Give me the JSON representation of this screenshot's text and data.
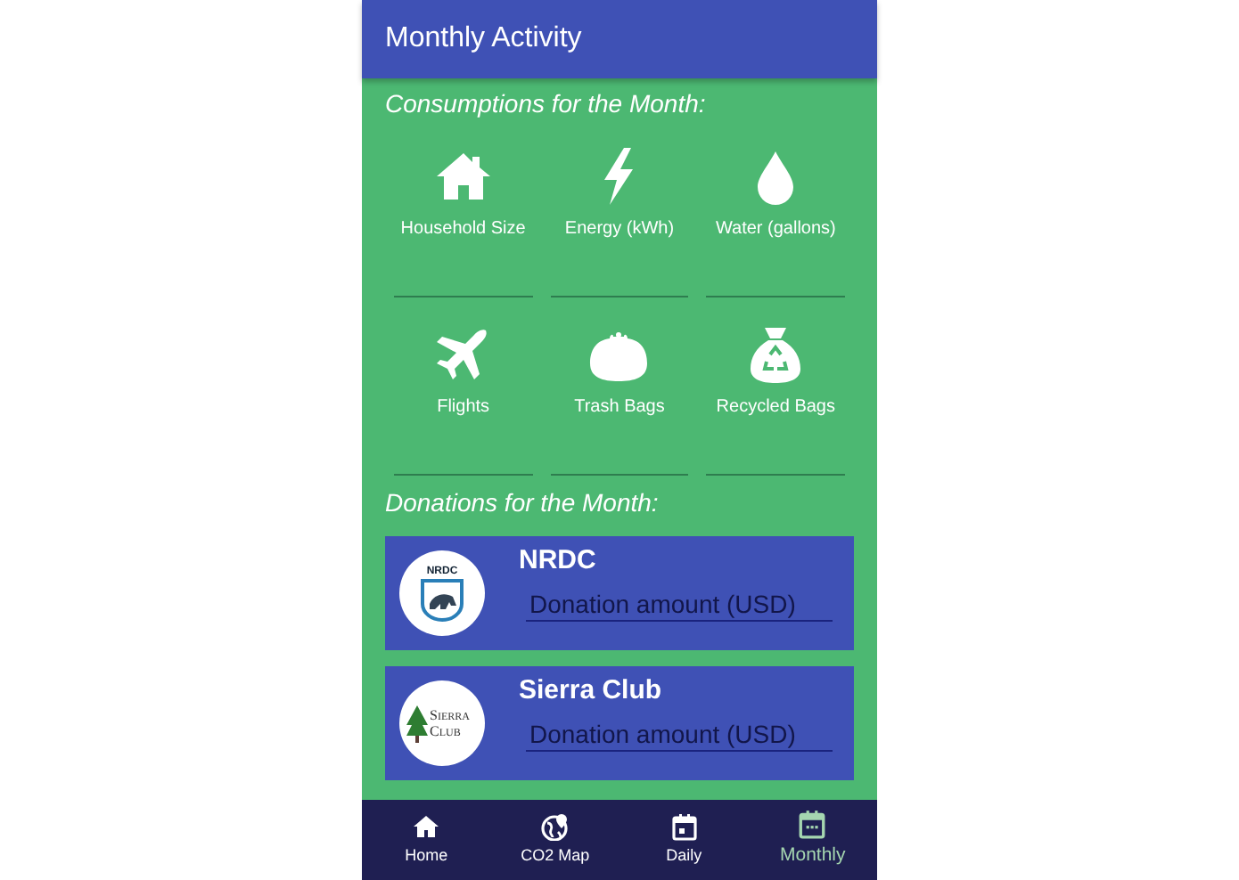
{
  "app_bar": {
    "title": "Monthly Activity"
  },
  "consumptions": {
    "heading": "Consumptions for the Month:",
    "items": [
      {
        "kind": "house",
        "label": "Household Size"
      },
      {
        "kind": "bolt",
        "label": "Energy (kWh)"
      },
      {
        "kind": "drop",
        "label": "Water (gallons)"
      },
      {
        "kind": "plane",
        "label": "Flights"
      },
      {
        "kind": "purse",
        "label": "Trash Bags"
      },
      {
        "kind": "recycle",
        "label": "Recycled Bags"
      }
    ]
  },
  "donations": {
    "heading": "Donations for the Month:",
    "items": [
      {
        "kind": "nrdc",
        "name": "NRDC",
        "logo_text": "NRDC",
        "placeholder": "Donation amount (USD)"
      },
      {
        "kind": "sierra",
        "name": "Sierra Club",
        "logo_text": "Sierra Club",
        "placeholder": "Donation amount (USD)"
      }
    ]
  },
  "bottom_nav": [
    {
      "kind": "home",
      "label": "Home",
      "selected": false
    },
    {
      "kind": "globe",
      "label": "CO2 Map",
      "selected": false
    },
    {
      "kind": "day",
      "label": "Daily",
      "selected": false
    },
    {
      "kind": "month",
      "label": "Monthly",
      "selected": true
    }
  ]
}
